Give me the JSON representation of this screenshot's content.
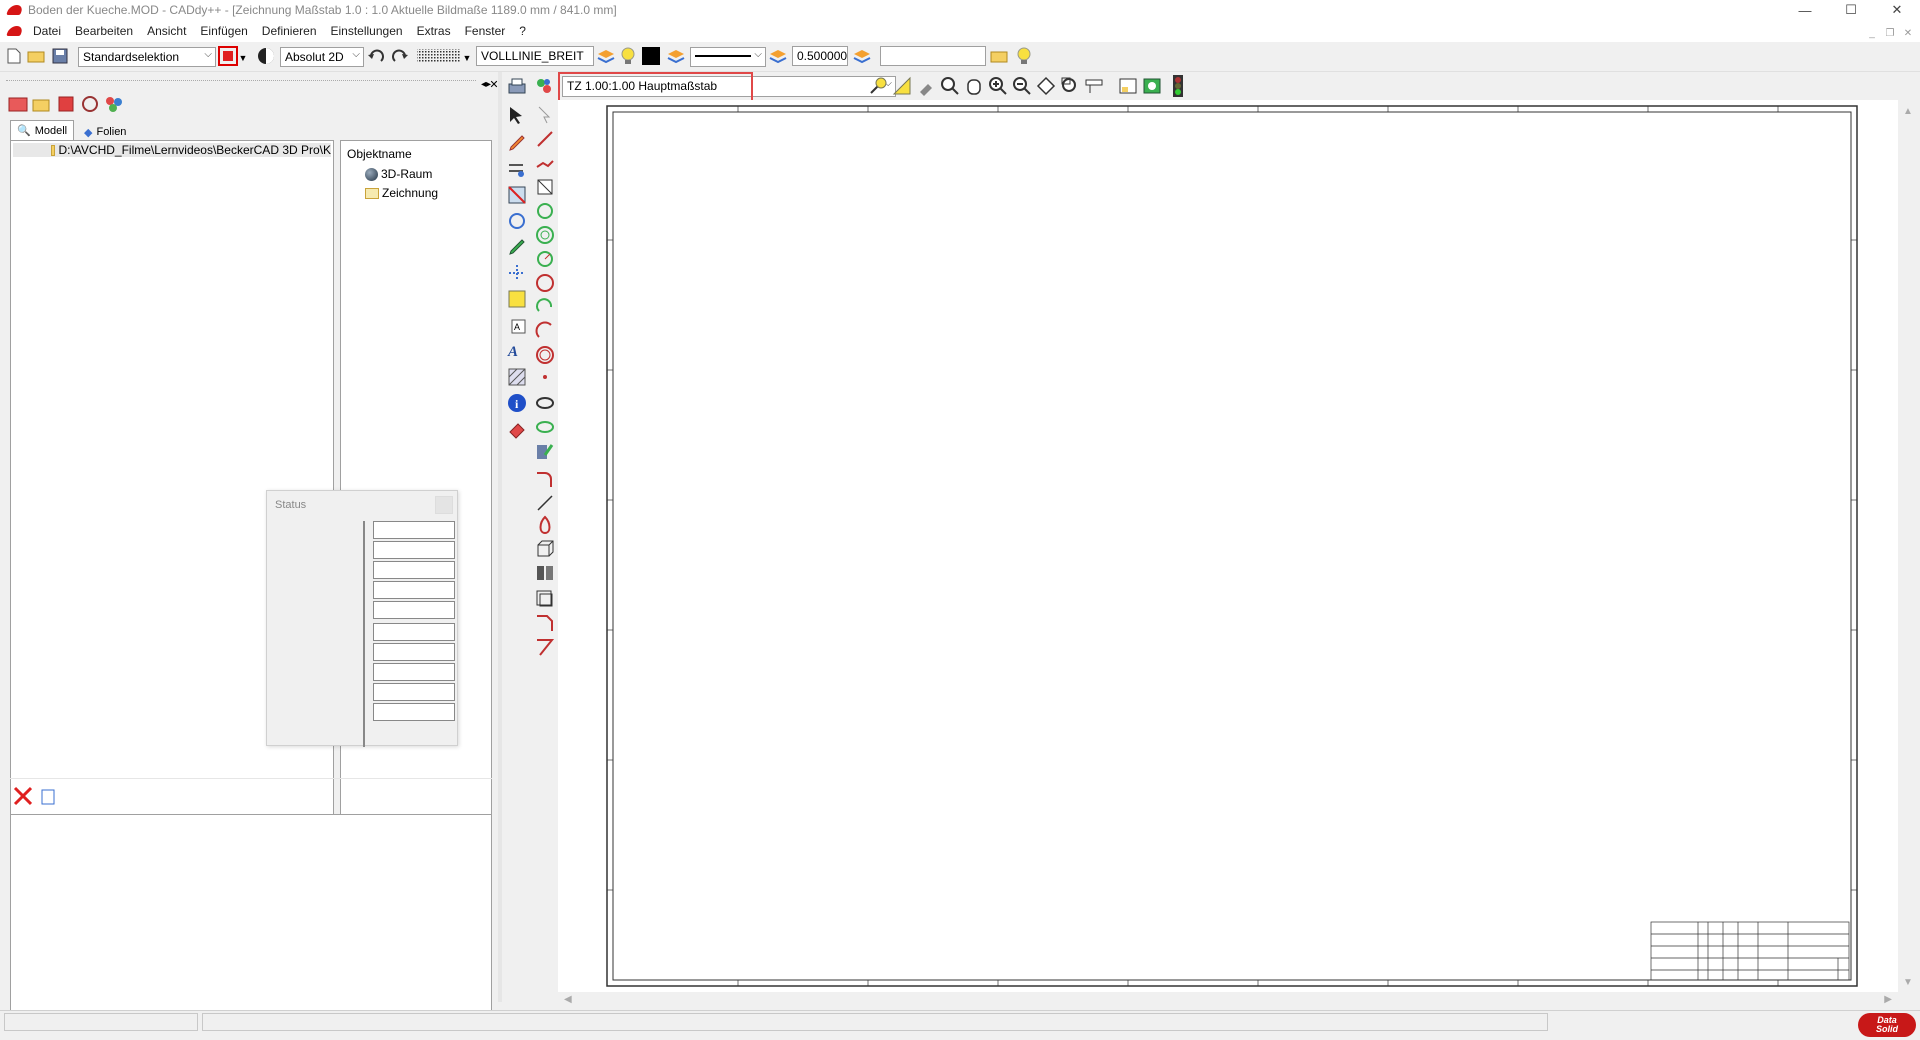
{
  "window": {
    "title": "Boden der Kueche.MOD  -  CADdy++ - [Zeichnung   Maßstab 1.0 : 1.0   Aktuelle Bildmaße 1189.0 mm / 841.0 mm]",
    "min": "—",
    "max": "☐",
    "close": "✕"
  },
  "menu": {
    "items": [
      "Datei",
      "Bearbeiten",
      "Ansicht",
      "Einfügen",
      "Definieren",
      "Einstellungen",
      "Extras",
      "Fenster",
      "?"
    ]
  },
  "toolbar": {
    "selection_mode": "Standardselektion",
    "coord_mode": "Absolut 2D",
    "line_type": "VOLLLINIE_BREIT",
    "line_width": "0.500000",
    "layer_name": ""
  },
  "scale_bar": {
    "scale_value": "TZ 1.00:1.00 Hauptmaßstab"
  },
  "left_panel": {
    "tabs": [
      "Modell",
      "Folien"
    ],
    "tree_path": "D:\\AVCHD_Filme\\Lernvideos\\BeckerCAD 3D Pro\\K",
    "object_header": "Objektname",
    "objects": [
      "3D-Raum",
      "Zeichnung"
    ]
  },
  "status_window": {
    "title": "Status"
  },
  "colors": {
    "accent_red": "#e04848",
    "title_text": "#888888",
    "current_color": "#000000"
  },
  "icons": {
    "logo": "DataSolid"
  }
}
